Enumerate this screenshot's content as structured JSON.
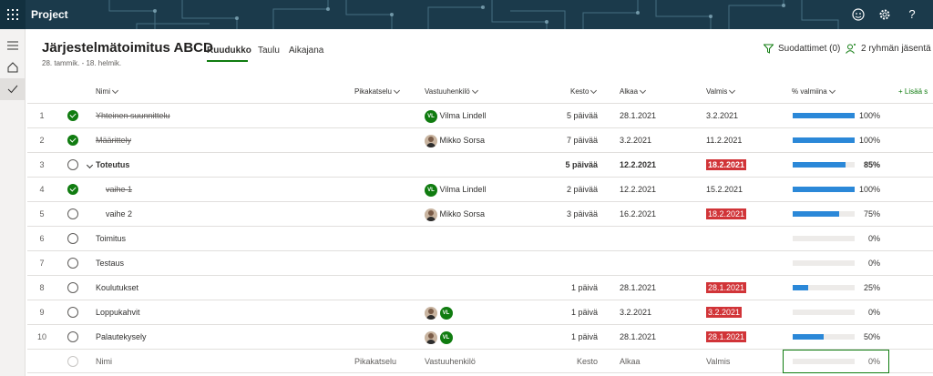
{
  "app": {
    "title": "Project"
  },
  "plan": {
    "title": "Järjestelmätoimitus ABCD",
    "dates": "28. tammik. - 18. helmik."
  },
  "views": [
    {
      "label": "Ruudukko"
    },
    {
      "label": "Taulu"
    },
    {
      "label": "Aikajana"
    }
  ],
  "toolbar": {
    "filters_label": "Suodattimet (0)",
    "members_label": "2 ryhmän jäsentä"
  },
  "columns": {
    "name": "Nimi",
    "quick": "Pikakatselu",
    "assignee": "Vastuuhenkilö",
    "duration": "Kesto",
    "start": "Alkaa",
    "finish": "Valmis",
    "percent": "% valmiina",
    "add": "Lisää s"
  },
  "tasks": [
    {
      "num": "1",
      "name": "Yhteinen suunnittelu",
      "assignee": "Vilma Lindell",
      "duration": "5 päivää",
      "start": "28.1.2021",
      "finish": "3.2.2021",
      "percent_label": "100%",
      "percent": 100
    },
    {
      "num": "2",
      "name": "Määrittely",
      "assignee": "Mikko Sorsa",
      "duration": "7 päivää",
      "start": "3.2.2021",
      "finish": "11.2.2021",
      "percent_label": "100%",
      "percent": 100
    },
    {
      "num": "3",
      "name": "Toteutus",
      "assignee": "",
      "duration": "5 päivää",
      "start": "12.2.2021",
      "finish": "18.2.2021",
      "percent_label": "85%",
      "percent": 85
    },
    {
      "num": "4",
      "name": "vaihe 1",
      "assignee": "Vilma Lindell",
      "duration": "2 päivää",
      "start": "12.2.2021",
      "finish": "15.2.2021",
      "percent_label": "100%",
      "percent": 100
    },
    {
      "num": "5",
      "name": "vaihe 2",
      "assignee": "Mikko Sorsa",
      "duration": "3 päivää",
      "start": "16.2.2021",
      "finish": "18.2.2021",
      "percent_label": "75%",
      "percent": 75
    },
    {
      "num": "6",
      "name": "Toimitus",
      "assignee": "",
      "duration": "",
      "start": "",
      "finish": "",
      "percent_label": "0%",
      "percent": 0
    },
    {
      "num": "7",
      "name": "Testaus",
      "assignee": "",
      "duration": "",
      "start": "",
      "finish": "",
      "percent_label": "0%",
      "percent": 0
    },
    {
      "num": "8",
      "name": "Koulutukset",
      "assignee": "",
      "duration": "1 päivä",
      "start": "28.1.2021",
      "finish": "28.1.2021",
      "percent_label": "25%",
      "percent": 25
    },
    {
      "num": "9",
      "name": "Loppukahvit",
      "assignee": "",
      "duration": "1 päivä",
      "start": "3.2.2021",
      "finish": "3.2.2021",
      "percent_label": "0%",
      "percent": 0
    },
    {
      "num": "10",
      "name": "Palautekysely",
      "assignee": "",
      "duration": "1 päivä",
      "start": "28.1.2021",
      "finish": "28.1.2021",
      "percent_label": "50%",
      "percent": 50
    }
  ],
  "avatars": {
    "vl_initials": "VL"
  },
  "new_row": {
    "name": "Nimi",
    "quick": "Pikakatselu",
    "assignee": "Vastuuhenkilö",
    "duration": "Kesto",
    "start": "Alkaa",
    "finish": "Valmis",
    "percent_label": "0%",
    "percent": 0
  },
  "colors": {
    "accent": "#107c10",
    "late": "#d13438",
    "progress": "#2b88d8",
    "header": "#1b3a4b"
  }
}
